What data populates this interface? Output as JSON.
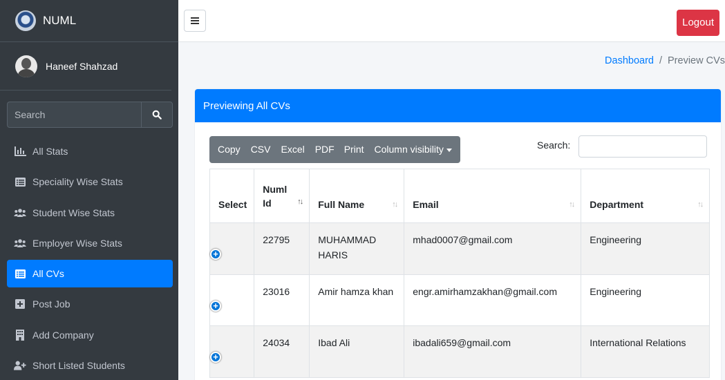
{
  "brand": {
    "name": "NUML"
  },
  "user": {
    "name": "Haneef Shahzad"
  },
  "sidebar_search": {
    "placeholder": "Search"
  },
  "nav": [
    {
      "label": "All Stats",
      "icon": "bar-chart-icon",
      "active": false
    },
    {
      "label": "Speciality Wise Stats",
      "icon": "list-icon",
      "active": false
    },
    {
      "label": "Student Wise Stats",
      "icon": "users-icon",
      "active": false
    },
    {
      "label": "Employer Wise Stats",
      "icon": "users-icon",
      "active": false
    },
    {
      "label": "All CVs",
      "icon": "list-icon",
      "active": true
    },
    {
      "label": "Post Job",
      "icon": "plus-square-icon",
      "active": false
    },
    {
      "label": "Add Company",
      "icon": "building-icon",
      "active": false
    },
    {
      "label": "Short Listed Students",
      "icon": "user-plus-icon",
      "active": false
    }
  ],
  "topbar": {
    "logout_label": "Logout"
  },
  "breadcrumb": {
    "home": "Dashboard",
    "separator": "/",
    "current": "Preview CVs"
  },
  "card": {
    "title": "Previewing All CVs"
  },
  "buttons": {
    "copy": "Copy",
    "csv": "CSV",
    "excel": "Excel",
    "pdf": "PDF",
    "print": "Print",
    "colvis": "Column visibility"
  },
  "table_search": {
    "label": "Search:",
    "value": ""
  },
  "table": {
    "headers": {
      "select": "Select",
      "numl_id": "Numl Id",
      "full_name": "Full Name",
      "email": "Email",
      "department": "Department"
    },
    "rows": [
      {
        "numl_id": "22795",
        "full_name": "MUHAMMAD HARIS",
        "email": "mhad0007@gmail.com",
        "department": "Engineering"
      },
      {
        "numl_id": "23016",
        "full_name": "Amir hamza khan",
        "email": "engr.amirhamzakhan@gmail.com",
        "department": "Engineering"
      },
      {
        "numl_id": "24034",
        "full_name": "Ibad Ali",
        "email": "ibadali659@gmail.com",
        "department": "International Relations"
      }
    ]
  },
  "colors": {
    "sidebar": "#343a40",
    "primary": "#007bff",
    "danger": "#dc3545",
    "secondary": "#6c757d"
  }
}
